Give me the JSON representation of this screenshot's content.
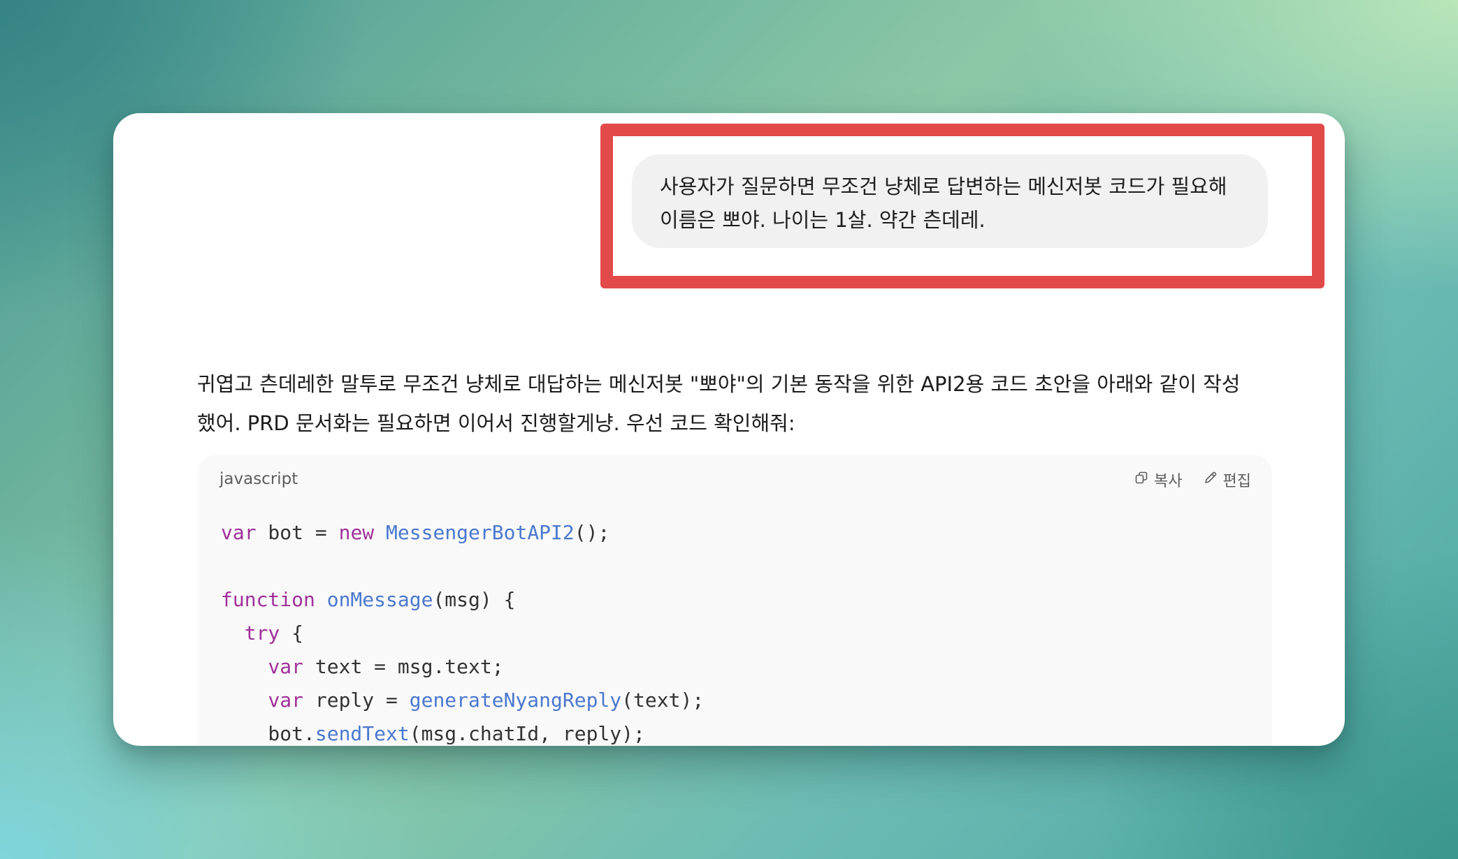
{
  "user_message": {
    "line1": "사용자가 질문하면 무조건 냥체로 답변하는 메신저봇 코드가 필요해",
    "line2": "이름은 뽀야. 나이는 1살. 약간 츤데레."
  },
  "assistant_message": {
    "line1": "귀엽고 츤데레한 말투로 무조건 냥체로 대답하는 메신저봇 \"뽀야\"의 기본 동작을 위한 API2용 코드 초안을 아래와 같이 작성",
    "line2": "했어. PRD 문서화는 필요하면 이어서 진행할게냥. 우선 코드 확인해줘:"
  },
  "code_block": {
    "language": "javascript",
    "copy_label": "복사",
    "edit_label": "편집",
    "icons": {
      "copy": "copy-icon",
      "edit": "pencil-icon"
    },
    "lines": [
      [
        {
          "t": "var",
          "c": "kw"
        },
        {
          "t": " bot = ",
          "c": ""
        },
        {
          "t": "new",
          "c": "kw"
        },
        {
          "t": " ",
          "c": ""
        },
        {
          "t": "MessengerBotAPI2",
          "c": "fn"
        },
        {
          "t": "();",
          "c": ""
        }
      ],
      [],
      [
        {
          "t": "function",
          "c": "kw"
        },
        {
          "t": " ",
          "c": ""
        },
        {
          "t": "onMessage",
          "c": "fn"
        },
        {
          "t": "(msg) {",
          "c": ""
        }
      ],
      [
        {
          "t": "  ",
          "c": ""
        },
        {
          "t": "try",
          "c": "kw"
        },
        {
          "t": " {",
          "c": ""
        }
      ],
      [
        {
          "t": "    ",
          "c": ""
        },
        {
          "t": "var",
          "c": "kw"
        },
        {
          "t": " text = msg.text;",
          "c": ""
        }
      ],
      [
        {
          "t": "    ",
          "c": ""
        },
        {
          "t": "var",
          "c": "kw"
        },
        {
          "t": " reply = ",
          "c": ""
        },
        {
          "t": "generateNyangReply",
          "c": "fn"
        },
        {
          "t": "(text);",
          "c": ""
        }
      ],
      [
        {
          "t": "    bot.",
          "c": ""
        },
        {
          "t": "sendText",
          "c": "fn"
        },
        {
          "t": "(msg.chatId, reply);",
          "c": ""
        }
      ]
    ]
  },
  "colors": {
    "highlight": "#e24a4a",
    "keyword": "#a0309a",
    "function": "#4a78cf"
  }
}
